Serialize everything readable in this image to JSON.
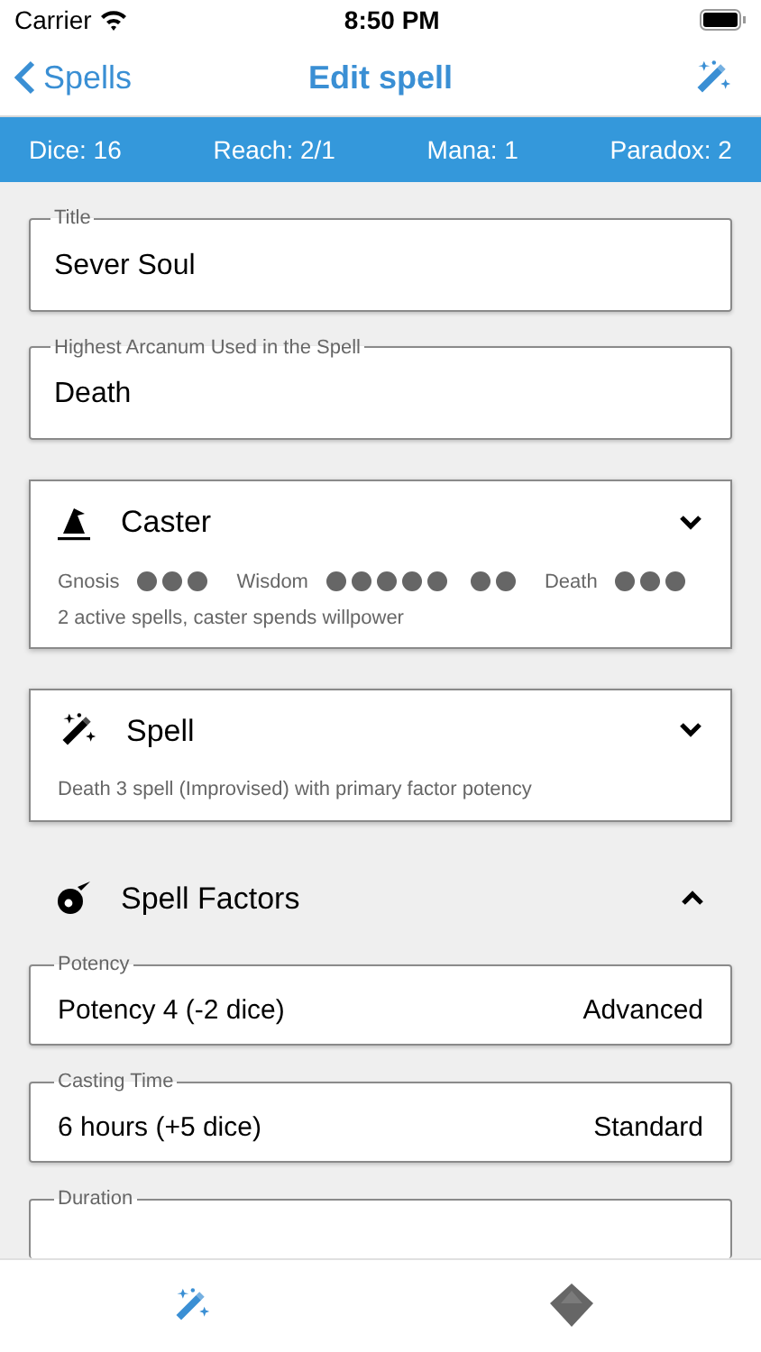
{
  "status_bar": {
    "carrier": "Carrier",
    "time": "8:50 PM"
  },
  "nav": {
    "back": "Spells",
    "title": "Edit spell"
  },
  "stats": [
    "Dice: 16",
    "Reach: 2/1",
    "Mana: 1",
    "Paradox: 2"
  ],
  "fields": [
    {
      "label": "Title",
      "value": "Sever Soul"
    },
    {
      "label": "Highest Arcanum Used in the Spell",
      "value": "Death"
    }
  ],
  "caster": {
    "title": "Caster",
    "expanded": false,
    "traits": [
      {
        "name": "Gnosis",
        "stars": 3
      },
      {
        "name": "Wisdom",
        "stars": 7
      },
      {
        "name": "Death",
        "stars": 3
      }
    ],
    "note": "2 active spells, caster spends willpower"
  },
  "spell": {
    "title": "Spell",
    "expanded": false,
    "note": "Death 3 spell (Improvised) with primary factor potency"
  },
  "spell_factors": {
    "title": "Spell Factors",
    "expanded": true,
    "factors": [
      {
        "label": "Potency",
        "value": "Potency 4 (-2 dice)",
        "mode": "Advanced"
      },
      {
        "label": "Casting Time",
        "value": "6 hours (+5 dice)",
        "mode": "Standard"
      },
      {
        "label": "Duration"
      }
    ]
  },
  "tabs": [
    {
      "kind": "wand",
      "selected": true
    },
    {
      "kind": "die",
      "selected": false
    }
  ]
}
